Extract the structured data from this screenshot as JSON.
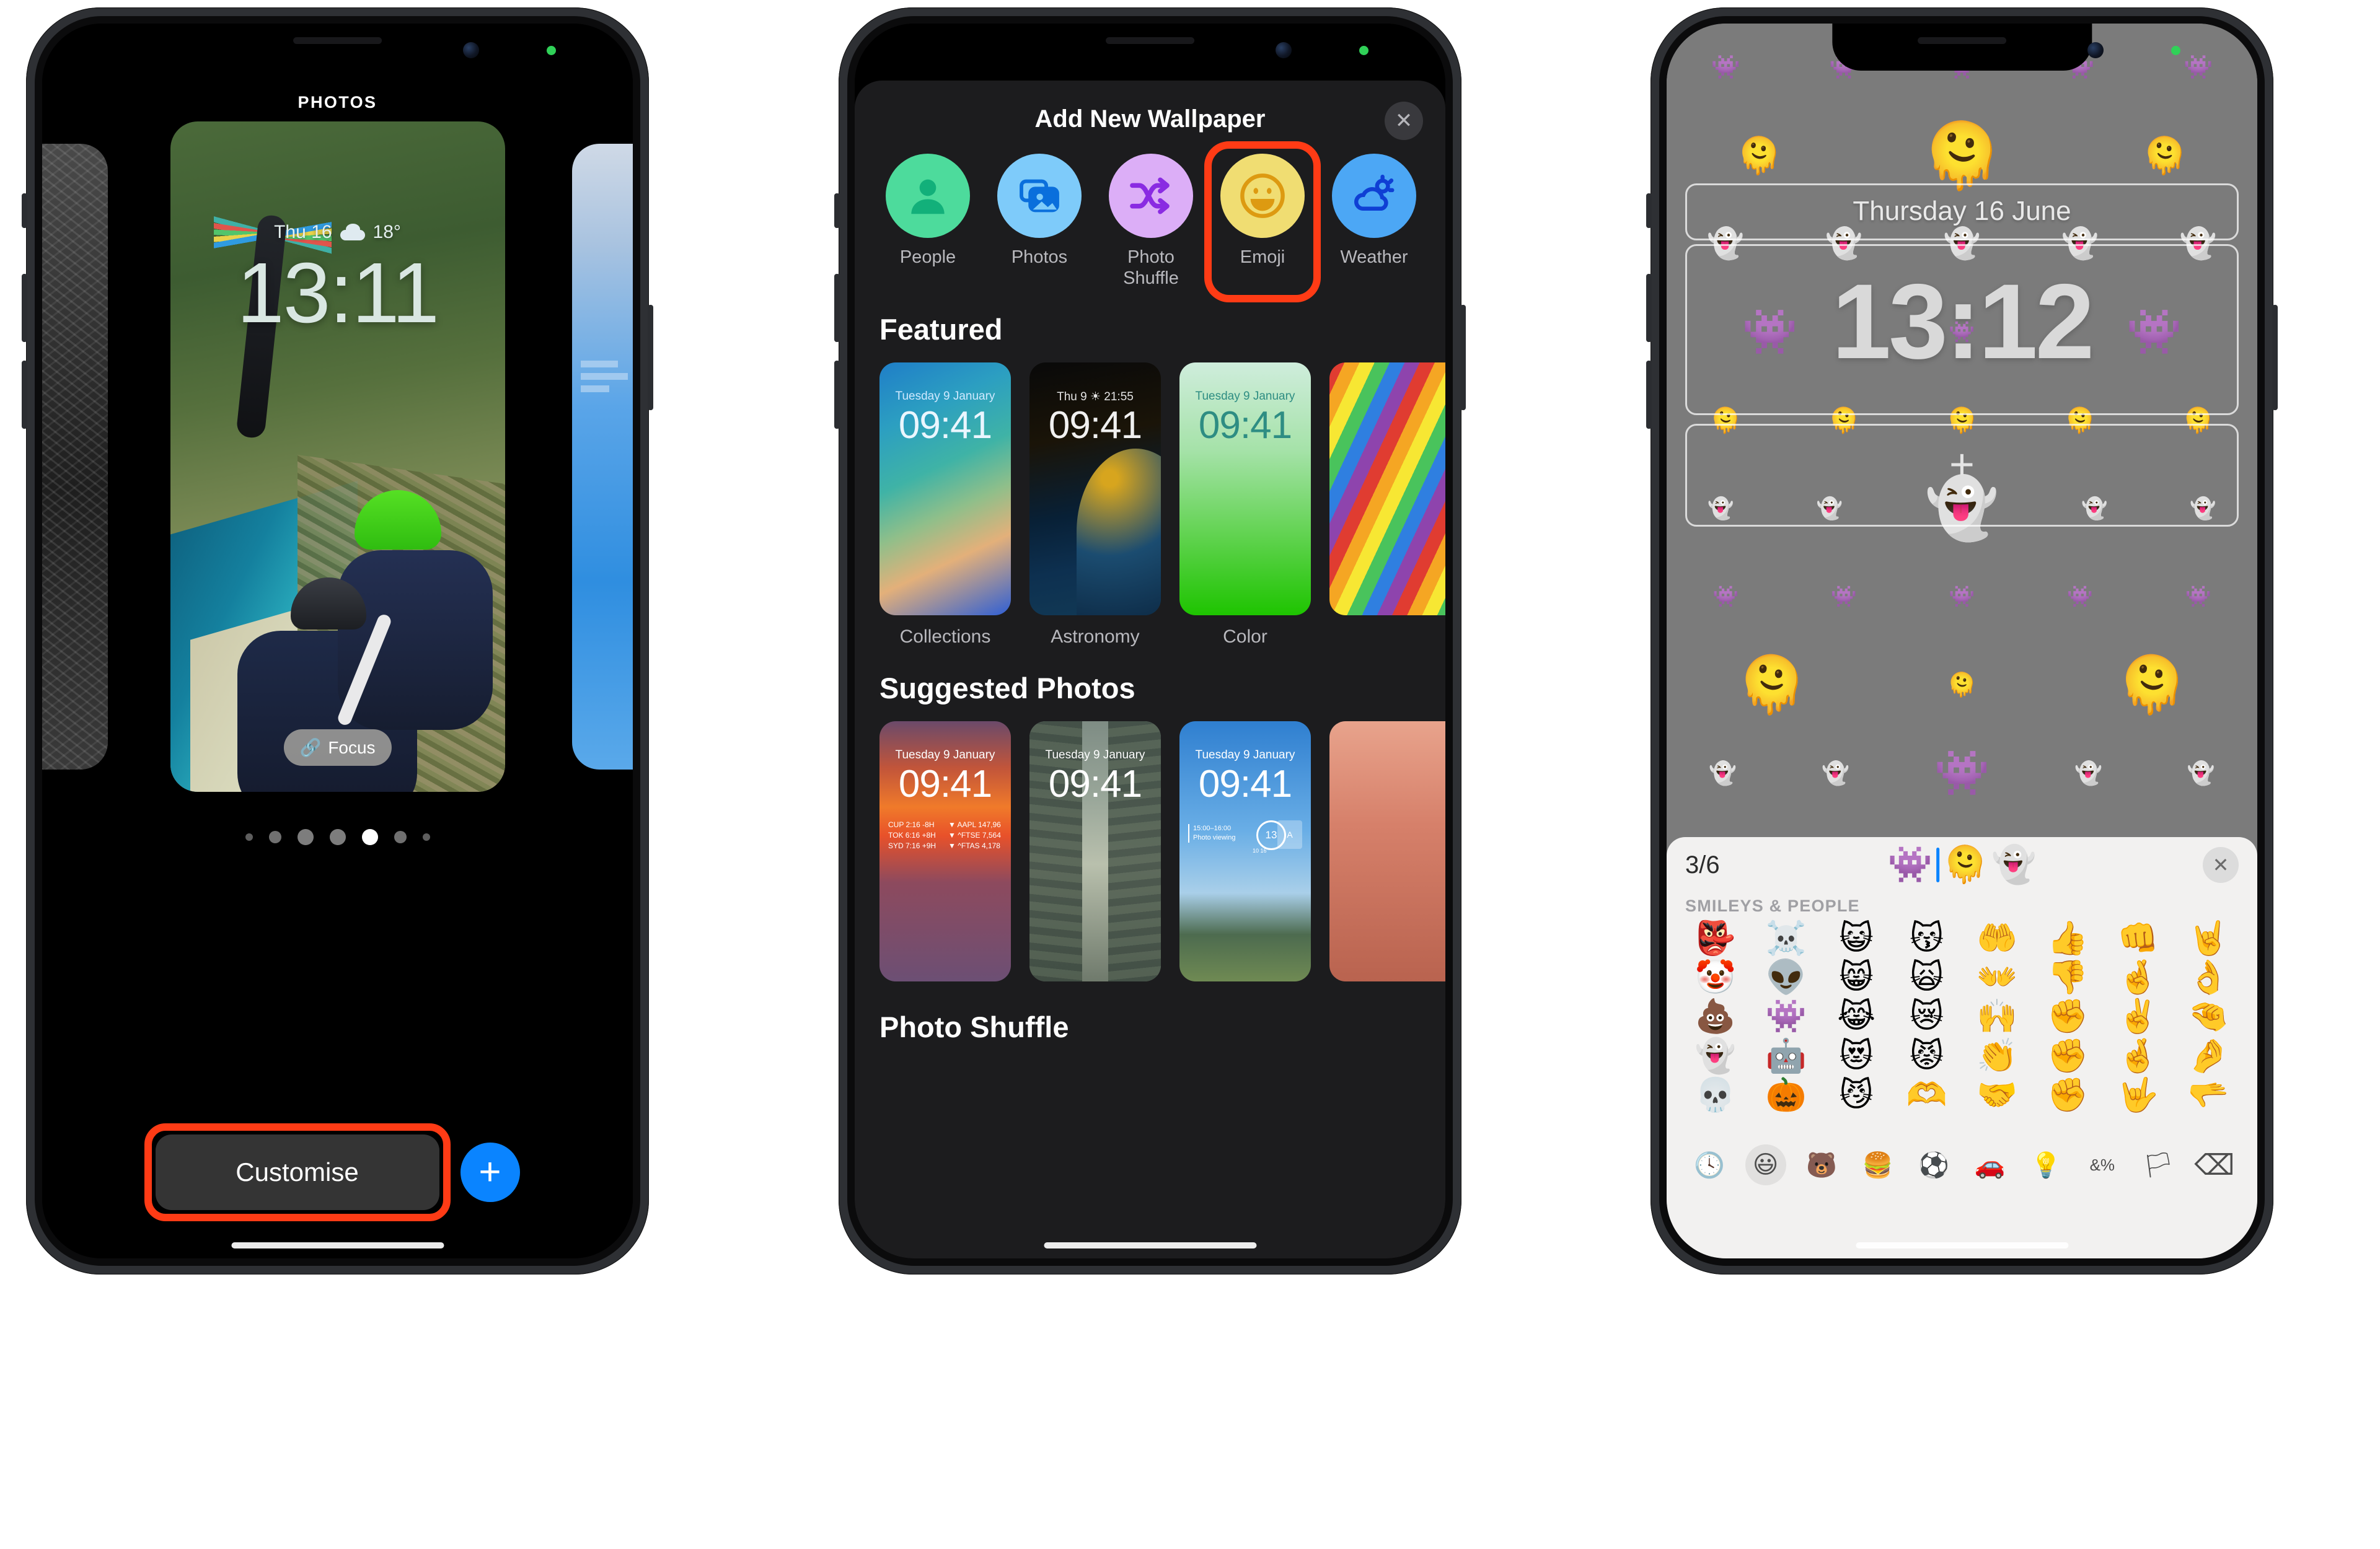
{
  "phone1": {
    "header": "PHOTOS",
    "lock": {
      "date": "Thu 16",
      "temp": "18°",
      "time": "13:11",
      "weather_icon": "cloud-icon"
    },
    "focus_pill": {
      "label": "Focus",
      "icon": "link-icon"
    },
    "page_dots": {
      "count": 7,
      "active_index": 4
    },
    "customise_button": "Customise",
    "add_button": "+"
  },
  "phone2": {
    "sheet_title": "Add New Wallpaper",
    "close_label": "✕",
    "types": [
      {
        "label": "People",
        "icon": "person-icon",
        "bg": "#4ddb9c",
        "fg": "#12b07a",
        "highlighted": false
      },
      {
        "label": "Photos",
        "icon": "photos-stack-icon",
        "bg": "#7ecbfa",
        "fg": "#0a6fdc",
        "highlighted": false
      },
      {
        "label": "Photo Shuffle",
        "icon": "shuffle-icon",
        "bg": "#dcaef7",
        "fg": "#8a2be2",
        "highlighted": false
      },
      {
        "label": "Emoji",
        "icon": "smiley-icon",
        "bg": "#f0dd72",
        "fg": "#dd9a11",
        "highlighted": true
      },
      {
        "label": "Weather",
        "icon": "weather-cloud-sun-icon",
        "bg": "#4ca7f5",
        "fg": "#0f3fd4",
        "highlighted": false
      }
    ],
    "featured": {
      "title": "Featured",
      "items": [
        {
          "label": "Collections",
          "date": "Tuesday 9 January",
          "time": "09:41"
        },
        {
          "label": "Astronomy",
          "date": "Thu 9  ☀  21:55",
          "time": "09:41"
        },
        {
          "label": "Color",
          "date": "Tuesday 9 January",
          "time": "09:41"
        },
        {
          "label": "",
          "date": "",
          "time": ""
        }
      ]
    },
    "suggested": {
      "title": "Suggested Photos",
      "items": [
        {
          "date": "Tuesday 9 January",
          "time": "09:41",
          "widgets": [
            "CUP  2:16  -8H",
            "TOK  6:16  +8H",
            "SYD  7:16  +9H",
            "▼ AAPL   147,96",
            "▼ ^FTSE   7,564",
            "▼ ^FTAS   4,178"
          ]
        },
        {
          "date": "Tuesday 9 January",
          "time": "09:41",
          "widgets": []
        },
        {
          "date": "Tuesday 9 January",
          "time": "09:41",
          "widgets": [
            "15:00–16:00",
            "Photo viewing",
            "13",
            "10   16"
          ]
        },
        {
          "date": "",
          "time": "",
          "widgets": []
        }
      ]
    },
    "next_section_title": "Photo Shuffle"
  },
  "phone3": {
    "lock": {
      "date": "Thursday 16 June",
      "time": "13:12",
      "widget_add": "+"
    },
    "wallpaper_emoji": [
      "🫠",
      "👻",
      "👾"
    ],
    "keyboard": {
      "count": "3/6",
      "selected_emoji": [
        "👾",
        "🫠",
        "👻"
      ],
      "close_label": "✕",
      "section_title": "SMILEYS & PEOPLE",
      "grid": [
        "👺",
        "☠️",
        "😺",
        "😽",
        "🤲",
        "👍",
        "👊",
        "🤘",
        "🤡",
        "👽",
        "😸",
        "🙀",
        "👐",
        "👎",
        "🤞",
        "👌",
        "💩",
        "👾",
        "😹",
        "😿",
        "🙌",
        "✊",
        "✌️",
        "🤏",
        "👻",
        "🤖",
        "😻",
        "😾",
        "👏",
        "✊",
        "🤞",
        "🤌",
        "💀",
        "🎃",
        "😼",
        "🫶",
        "🤝",
        "✊",
        "🤟",
        "🫳"
      ],
      "categories": [
        {
          "icon": "clock-icon",
          "glyph": "🕓",
          "active": false
        },
        {
          "icon": "smiley-icon",
          "glyph": "😃",
          "active": true
        },
        {
          "icon": "animals-icon",
          "glyph": "🐻",
          "active": false
        },
        {
          "icon": "food-icon",
          "glyph": "🍔",
          "active": false
        },
        {
          "icon": "sports-icon",
          "glyph": "⚽",
          "active": false
        },
        {
          "icon": "travel-icon",
          "glyph": "🚗",
          "active": false
        },
        {
          "icon": "objects-icon",
          "glyph": "💡",
          "active": false
        },
        {
          "icon": "symbols-icon",
          "glyph": "&%",
          "active": false
        },
        {
          "icon": "flags-icon",
          "glyph": "🏳",
          "active": false
        },
        {
          "icon": "backspace-icon",
          "glyph": "⌫",
          "active": false
        }
      ]
    }
  },
  "colors": {
    "highlight": "#ff3b15",
    "accent_blue": "#0a84ff",
    "sheet_bg": "#1c1c1e",
    "keyboard_bg": "#f2f1f0"
  }
}
